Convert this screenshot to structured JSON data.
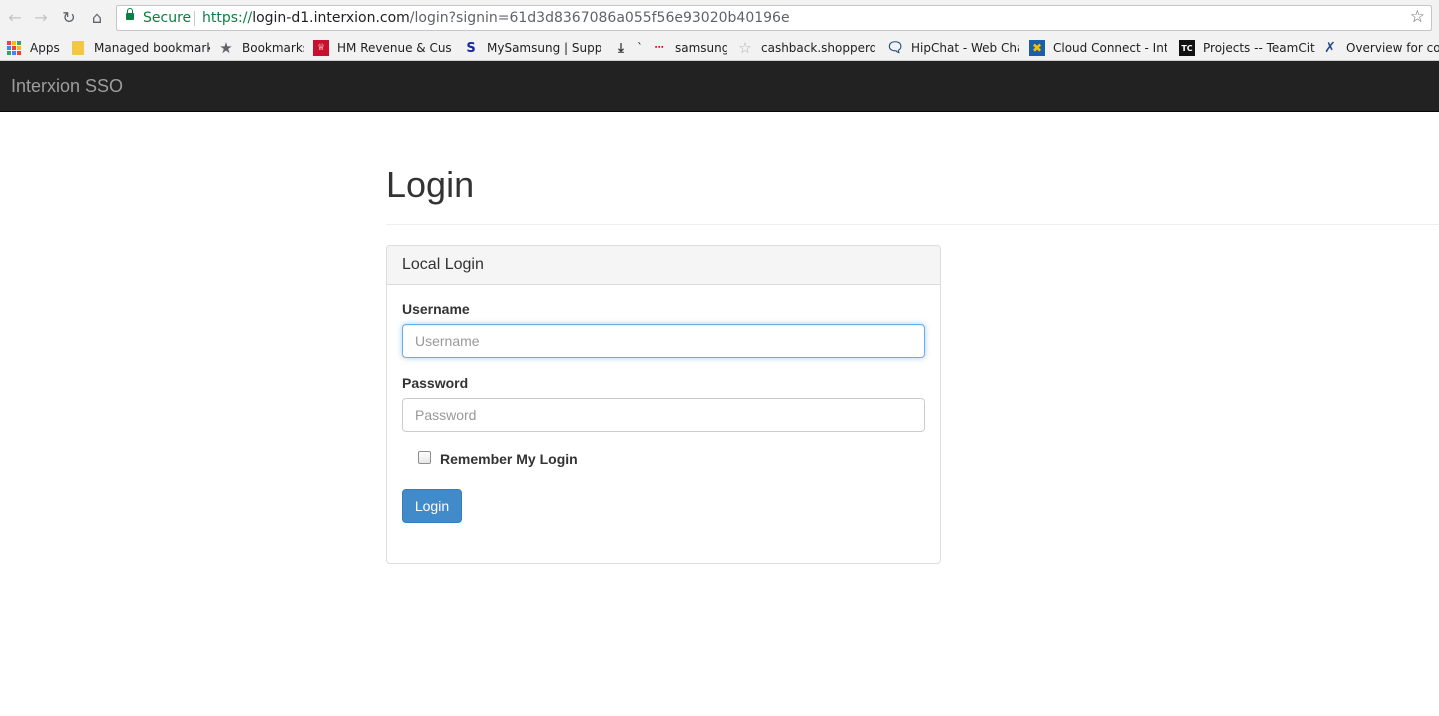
{
  "browser": {
    "secure_label": "Secure",
    "url_scheme": "https://",
    "url_host": "login-d1.interxion.com",
    "url_path": "/login?signin=61d3d8367086a055f56e93020b40196e",
    "bookmarks": [
      {
        "label": "Apps",
        "icon": "apps-grid-icon"
      },
      {
        "label": "Managed bookmarks",
        "icon": "folder-icon"
      },
      {
        "label": "Bookmarks",
        "icon": "star-icon"
      },
      {
        "label": "HM Revenue & Custo",
        "icon": "hmrc-icon"
      },
      {
        "label": "MySamsung | Suppor",
        "icon": "samsung-s-icon"
      },
      {
        "label": "`",
        "icon": "download-icon"
      },
      {
        "label": "samsung",
        "icon": "dots-icon"
      },
      {
        "label": "cashback.shopperdisc",
        "icon": "star-outline-icon"
      },
      {
        "label": "HipChat - Web Chat",
        "icon": "hipchat-icon"
      },
      {
        "label": "Cloud Connect - Inter",
        "icon": "cloud-connect-icon"
      },
      {
        "label": "Projects -- TeamCity",
        "icon": "teamcity-icon"
      },
      {
        "label": "Overview for com",
        "icon": "overview-icon"
      }
    ]
  },
  "navbar": {
    "brand": "Interxion SSO"
  },
  "page": {
    "title": "Login"
  },
  "panel": {
    "heading": "Local Login",
    "username_label": "Username",
    "username_placeholder": "Username",
    "password_label": "Password",
    "password_placeholder": "Password",
    "remember_label": "Remember My Login",
    "login_button": "Login"
  },
  "colors": {
    "navbar_bg": "#222222",
    "button_primary": "#428bca",
    "secure_green": "#0b8043"
  }
}
